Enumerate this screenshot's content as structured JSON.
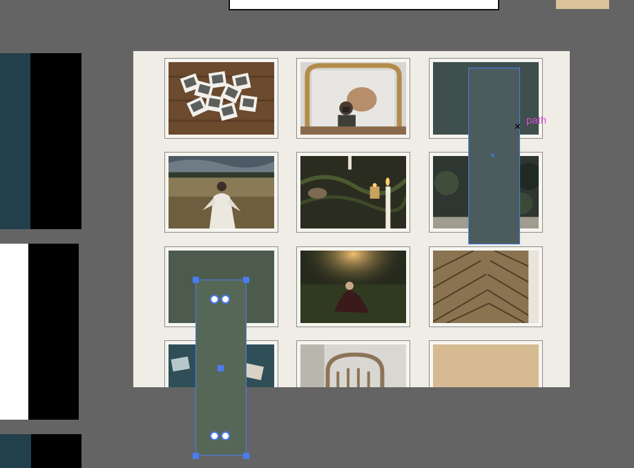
{
  "canvas": {
    "background_color": "#646464",
    "artboard_color": "#efede6"
  },
  "swatches": {
    "top": "#dcc39a",
    "left": [
      {
        "primary": "#22404c",
        "secondary": "#000000"
      },
      {
        "primary": "#ffffff",
        "secondary": "#000000"
      },
      {
        "primary": "#22404c",
        "secondary": "#000000"
      }
    ]
  },
  "grid": {
    "tiles": [
      {
        "name": "polaroids-on-wood-photo"
      },
      {
        "name": "mirror-selfie-photo"
      },
      {
        "name": "dark-teal-color-block",
        "fill": "#3f4f4d"
      },
      {
        "name": "woman-in-field-photo"
      },
      {
        "name": "candle-table-photo"
      },
      {
        "name": "greenery-candle-photo"
      },
      {
        "name": "sage-green-color-block",
        "fill": "#4c5b4c"
      },
      {
        "name": "woman-sunset-photo"
      },
      {
        "name": "chevron-wood-photo"
      },
      {
        "name": "teal-desk-photo"
      },
      {
        "name": "rattan-chair-photo"
      },
      {
        "name": "tan-color-block",
        "fill": "#d6bb92"
      }
    ]
  },
  "selection": {
    "accent": "#4a7cf0",
    "path_label": "path",
    "path_label_color": "#d44fd6",
    "rect_a_fill": "#4c5c5c",
    "rect_b_fill": "#576757"
  }
}
